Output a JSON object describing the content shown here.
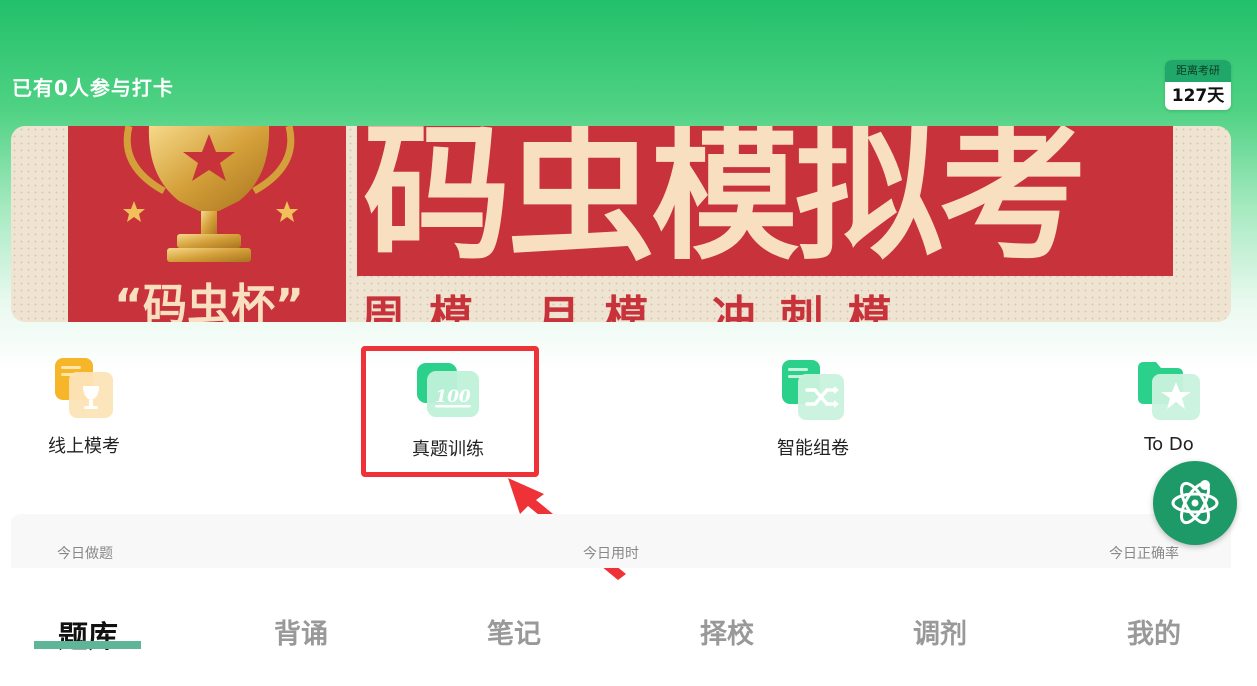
{
  "header": {
    "checkin_text": "已有0人参与打卡",
    "countdown_label": "距离考研",
    "countdown_value": "127天"
  },
  "banner": {
    "title": "码虫模拟考",
    "cup_label": "“码虫杯”",
    "subtitle": "周模 月模 冲刺模"
  },
  "features": [
    {
      "label": "线上模考",
      "icon": "trophy-card-icon"
    },
    {
      "label": "真题训练",
      "icon": "score-100-icon"
    },
    {
      "label": "智能组卷",
      "icon": "shuffle-icon"
    },
    {
      "label": "To Do",
      "icon": "star-folder-icon"
    }
  ],
  "stats": {
    "today_questions_label": "今日做题",
    "today_time_label": "今日用时",
    "today_accuracy_label": "今日正确率"
  },
  "tabbar": {
    "items": [
      "题库",
      "背诵",
      "笔记",
      "择校",
      "调剂",
      "我的"
    ],
    "active": "题库"
  },
  "colors": {
    "accent_green": "#22c06a",
    "banner_red": "#c8323a",
    "highlight_red": "#ef3237",
    "fab_green": "#1e9a68"
  },
  "fab_icon": "atom-icon"
}
